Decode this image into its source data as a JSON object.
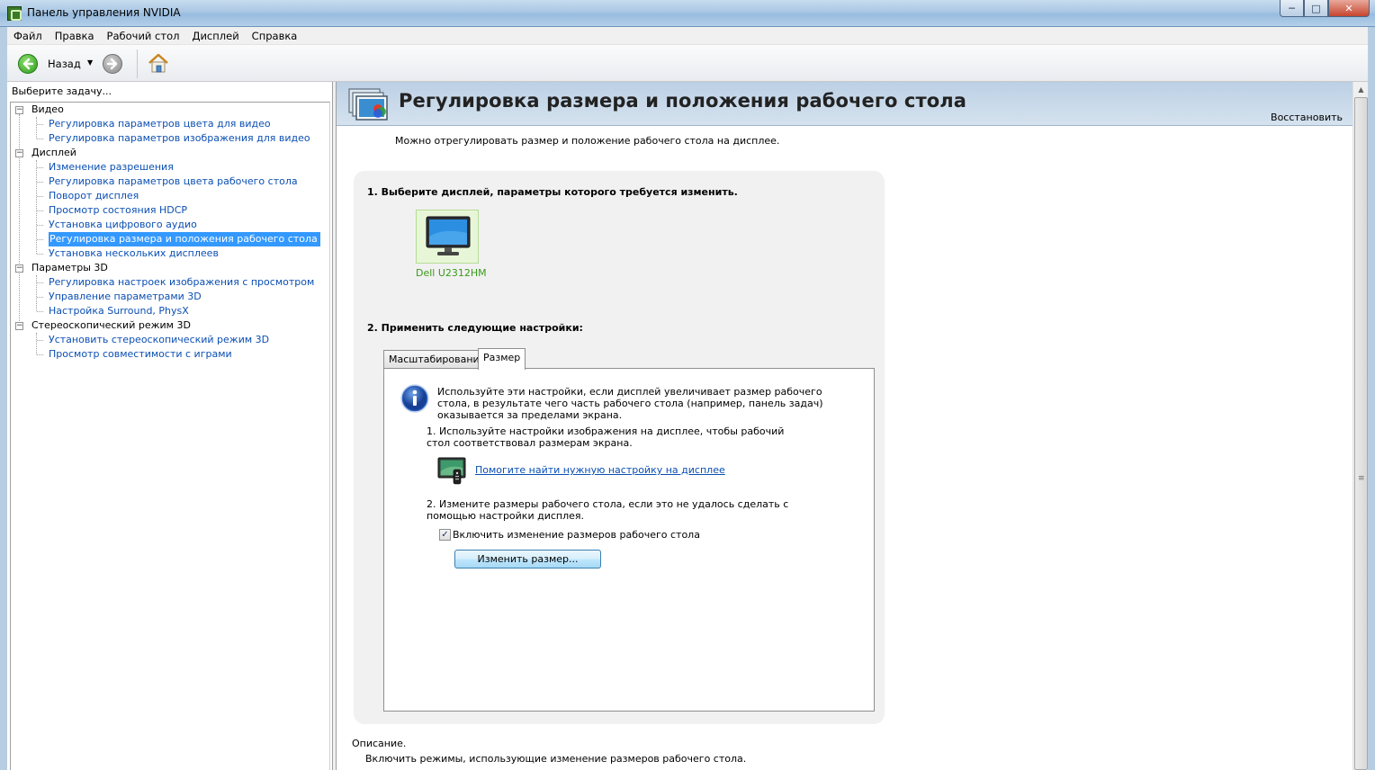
{
  "window": {
    "title": "Панель управления NVIDIA",
    "controls": {
      "minimize": "─",
      "maximize": "□",
      "close": "✕"
    }
  },
  "menu": [
    "Файл",
    "Правка",
    "Рабочий стол",
    "Дисплей",
    "Справка"
  ],
  "toolbar": {
    "back_label": "Назад",
    "back_icon": "back-arrow-icon",
    "forward_icon": "forward-arrow-icon",
    "home_icon": "home-icon",
    "dropdown": "▼"
  },
  "sidebar": {
    "header": "Выберите задачу...",
    "categories": [
      {
        "label": "Видео",
        "toggle": "−",
        "items": [
          "Регулировка параметров цвета для видео",
          "Регулировка параметров изображения для видео"
        ]
      },
      {
        "label": "Дисплей",
        "toggle": "−",
        "items": [
          "Изменение разрешения",
          "Регулировка параметров цвета рабочего стола",
          "Поворот дисплея",
          "Просмотр состояния HDCP",
          "Установка цифрового аудио",
          "Регулировка размера и положения рабочего стола",
          "Установка нескольких дисплеев"
        ]
      },
      {
        "label": "Параметры 3D",
        "toggle": "−",
        "items": [
          "Регулировка настроек изображения с просмотром",
          "Управление параметрами 3D",
          "Настройка Surround, PhysX"
        ]
      },
      {
        "label": "Стереоскопический режим 3D",
        "toggle": "−",
        "items": [
          "Установить стереоскопический режим 3D",
          "Просмотр совместимости с играми"
        ]
      }
    ]
  },
  "main": {
    "title": "Регулировка размера и положения рабочего стола",
    "restore": "Восстановить",
    "intro": "Можно отрегулировать размер и положение рабочего стола на дисплее.",
    "step1": "1. Выберите дисплей, параметры которого требуется изменить.",
    "display_name": "Dell U2312HM",
    "step2": "2. Применить следующие настройки:",
    "tabs": [
      "Масштабирование",
      "Размер"
    ],
    "active_tab": "Размер",
    "info_text": "Используйте эти настройки, если дисплей увеличивает размер рабочего стола, в результате чего часть рабочего стола (например, панель задач) оказывается за пределами экрана.",
    "item1": "1. Используйте настройки изображения на дисплее, чтобы рабочий стол соответствовал размерам экрана.",
    "help_link": "Помогите найти нужную настройку на дисплее",
    "item2": "2. Измените размеры рабочего стола, если это не удалось сделать с помощью настройки дисплея.",
    "checkbox_label": "Включить изменение размеров рабочего стола",
    "checkbox_checked": true,
    "checkbox_mark": "✓",
    "resize_button": "Изменить размер...",
    "description_label": "Описание.",
    "description_text": "Включить режимы, использующие изменение размеров рабочего стола."
  },
  "colors": {
    "link": "#0b4fb3",
    "selected": "#3399ff",
    "header_band": "#c9d9ea",
    "display_name": "#3a9a1a"
  },
  "scrollbar": {
    "up": "▲",
    "grip": "≡"
  }
}
